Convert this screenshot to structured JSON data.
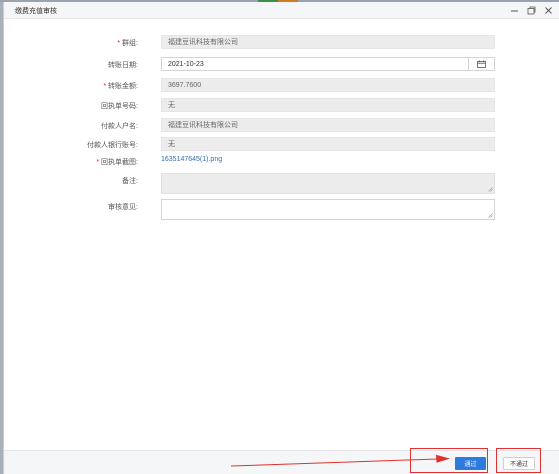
{
  "window": {
    "title": "缴费充值审核"
  },
  "form": {
    "applicant": {
      "label": "群组:",
      "value": "福建豆讯科技有限公司",
      "required": true
    },
    "transfer_date": {
      "label": "转账日期:",
      "value": "2021-10-23",
      "required": false
    },
    "transfer_amount": {
      "label": "转账金额:",
      "value": "3697.7600",
      "required": true
    },
    "receipt_number": {
      "label": "回执单号码:",
      "value": "无",
      "required": false
    },
    "payer_name": {
      "label": "付款人户名:",
      "value": "福建豆讯科技有限公司",
      "required": false
    },
    "payer_bank_account": {
      "label": "付款人银行账号:",
      "value": "无",
      "required": false
    },
    "receipt_screenshot": {
      "label": "回执单截图:",
      "value": "1635147645(1).png",
      "required": true
    },
    "remarks": {
      "label": "备注:",
      "value": ""
    },
    "review_opinion": {
      "label": "审核意见:",
      "value": ""
    }
  },
  "footer": {
    "pass_label": "通过",
    "reject_label": "不通过"
  },
  "colors": {
    "primary": "#2e7be0",
    "required": "#e02020",
    "link": "#2f6fb5",
    "annotation": "#e03030"
  },
  "icons": [
    "minimize-icon",
    "restore-icon",
    "close-icon",
    "calendar-icon"
  ]
}
